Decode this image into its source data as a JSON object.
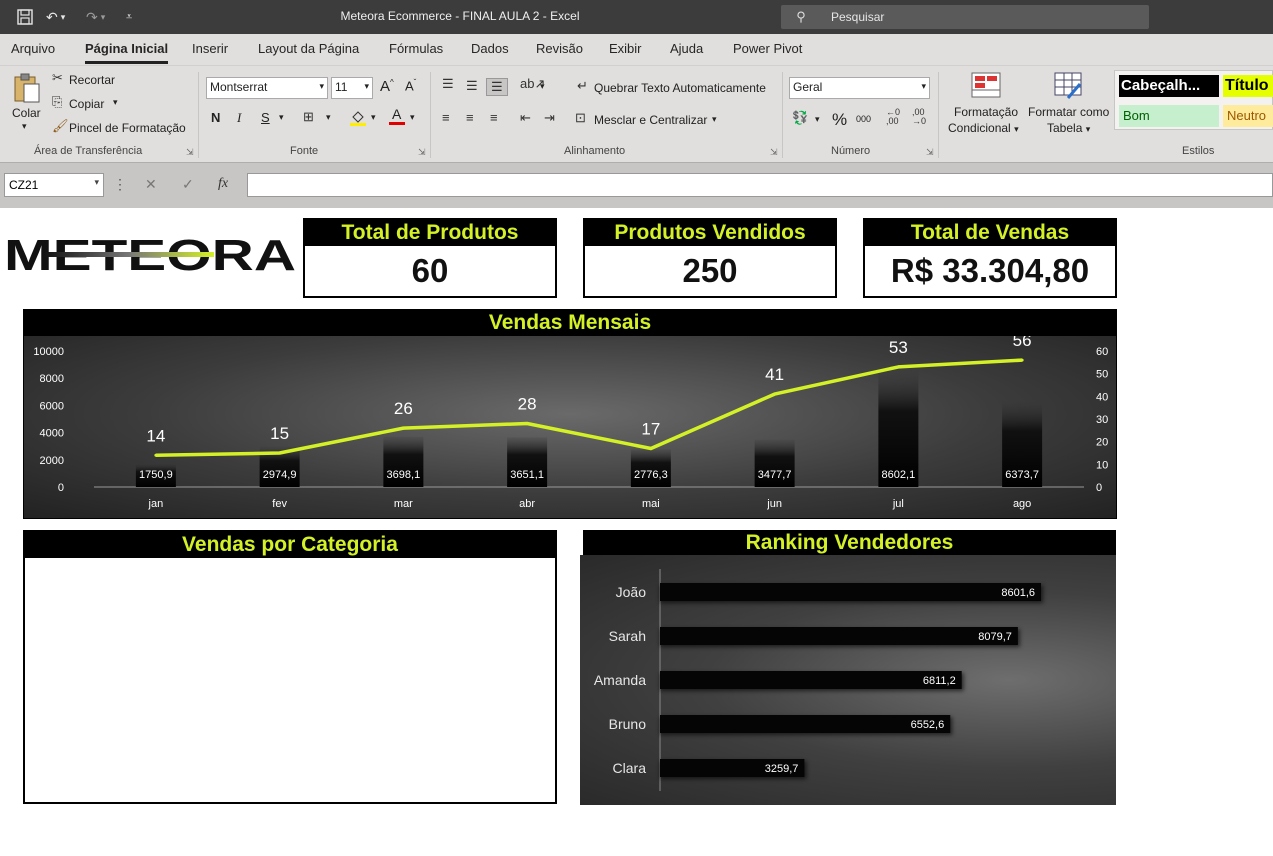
{
  "titlebar": {
    "title": "Meteora Ecommerce - FINAL AULA 2  -  Excel",
    "search_placeholder": "Pesquisar"
  },
  "menu": {
    "tabs": [
      "Arquivo",
      "Página Inicial",
      "Inserir",
      "Layout da Página",
      "Fórmulas",
      "Dados",
      "Revisão",
      "Exibir",
      "Ajuda",
      "Power Pivot"
    ],
    "active": "Página Inicial"
  },
  "ribbon": {
    "clipboard": {
      "paste": "Colar",
      "cut": "Recortar",
      "copy": "Copiar",
      "format_painter": "Pincel de Formatação",
      "label": "Área de Transferência"
    },
    "font": {
      "family": "Montserrat",
      "size": "11",
      "bold": "N",
      "italic": "I",
      "underline": "S",
      "grow": "A",
      "shrink": "A",
      "label": "Fonte"
    },
    "alignment": {
      "wrap": "Quebrar Texto Automaticamente",
      "merge": "Mesclar e Centralizar",
      "label": "Alinhamento"
    },
    "number": {
      "format": "Geral",
      "percent": "%",
      "thousands": "000",
      "label": "Número"
    },
    "styles": {
      "conditional": "Formatação Condicional",
      "conditional_l1": "Formatação",
      "conditional_l2": "Condicional",
      "table_l1": "Formatar como",
      "table_l2": "Tabela",
      "heading": "Cabeçalh...",
      "title": "Título",
      "good": "Bom",
      "neutral": "Neutro",
      "label": "Estilos"
    }
  },
  "formula_bar": {
    "name_box": "CZ21",
    "cancel": "✕",
    "confirm": "✓",
    "fx": "fx",
    "value": ""
  },
  "dashboard": {
    "logo": "METEORA",
    "kpis": [
      {
        "title": "Total de Produtos",
        "value": "60"
      },
      {
        "title": "Produtos Vendidos",
        "value": "250"
      },
      {
        "title": "Total de Vendas",
        "value": "R$ 33.304,80"
      }
    ],
    "monthly_title": "Vendas Mensais",
    "category_title": "Vendas por Categoria",
    "ranking_title": "Ranking Vendedores"
  },
  "colors": {
    "accent": "#d4f026",
    "dark": "#000000",
    "ribbon": "#e1dfdd",
    "titlebar": "#3c3c3c"
  },
  "chart_data": [
    {
      "type": "bar",
      "title": "Vendas Mensais",
      "categories": [
        "jan",
        "fev",
        "mar",
        "abr",
        "mai",
        "jun",
        "jul",
        "ago"
      ],
      "series": [
        {
          "values": [
            1750.9,
            2974.9,
            3698.1,
            3651.1,
            2776.3,
            3477.7,
            8602.1,
            6373.7
          ],
          "labels": [
            "1750,9",
            "2974,9",
            "3698,1",
            "3651,1",
            "2776,3",
            "3477,7",
            "8602,1",
            "6373,7"
          ],
          "axis": "left"
        },
        {
          "type": "line",
          "values": [
            14,
            15,
            26,
            28,
            17,
            41,
            53,
            56
          ],
          "axis": "right"
        }
      ],
      "y_left": {
        "ticks": [
          0,
          2000,
          4000,
          6000,
          8000,
          10000
        ],
        "range": [
          0,
          10000
        ]
      },
      "y_right": {
        "ticks": [
          0,
          10,
          20,
          30,
          40,
          50,
          60
        ],
        "range": [
          0,
          60
        ]
      }
    },
    {
      "type": "bar",
      "orientation": "horizontal",
      "title": "Ranking Vendedores",
      "categories": [
        "João",
        "Sarah",
        "Amanda",
        "Bruno",
        "Clara"
      ],
      "values": [
        8601.6,
        8079.7,
        6811.2,
        6552.6,
        3259.7
      ],
      "labels": [
        "8601,6",
        "8079,7",
        "6811,2",
        "6552,6",
        "3259,7"
      ]
    }
  ]
}
